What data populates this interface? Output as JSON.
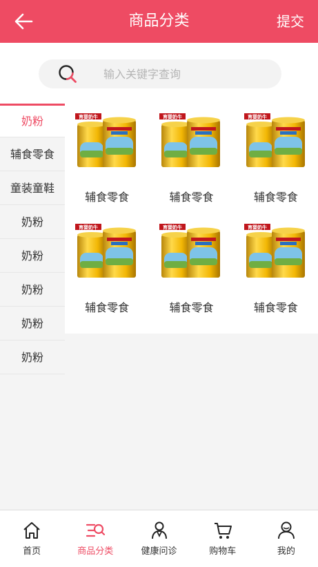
{
  "colors": {
    "accent": "#ee4b63",
    "background": "#f4f4f4"
  },
  "header": {
    "title": "商品分类",
    "submit_label": "提交",
    "back_icon": "arrow-left-icon"
  },
  "search": {
    "placeholder": "输入关键字查询",
    "value": "",
    "icon": "search-icon"
  },
  "sidebar": {
    "items": [
      {
        "label": "奶粉",
        "active": true
      },
      {
        "label": "辅食零食",
        "active": false
      },
      {
        "label": "童装童鞋",
        "active": false
      },
      {
        "label": "奶粉",
        "active": false
      },
      {
        "label": "奶粉",
        "active": false
      },
      {
        "label": "奶粉",
        "active": false
      },
      {
        "label": "奶粉",
        "active": false
      },
      {
        "label": "奶粉",
        "active": false
      }
    ]
  },
  "products": [
    {
      "name": "辅食零食",
      "image_text": "育婴奶牛"
    },
    {
      "name": "辅食零食",
      "image_text": "育婴奶牛"
    },
    {
      "name": "辅食零食",
      "image_text": "育婴奶牛"
    },
    {
      "name": "辅食零食",
      "image_text": "育婴奶牛"
    },
    {
      "name": "辅食零食",
      "image_text": "育婴奶牛"
    },
    {
      "name": "辅食零食",
      "image_text": "育婴奶牛"
    }
  ],
  "tabbar": {
    "items": [
      {
        "label": "首页",
        "icon": "home-icon",
        "active": false
      },
      {
        "label": "商品分类",
        "icon": "category-icon",
        "active": true
      },
      {
        "label": "健康问诊",
        "icon": "doctor-icon",
        "active": false
      },
      {
        "label": "购物车",
        "icon": "cart-icon",
        "active": false
      },
      {
        "label": "我的",
        "icon": "user-icon",
        "active": false
      }
    ]
  }
}
